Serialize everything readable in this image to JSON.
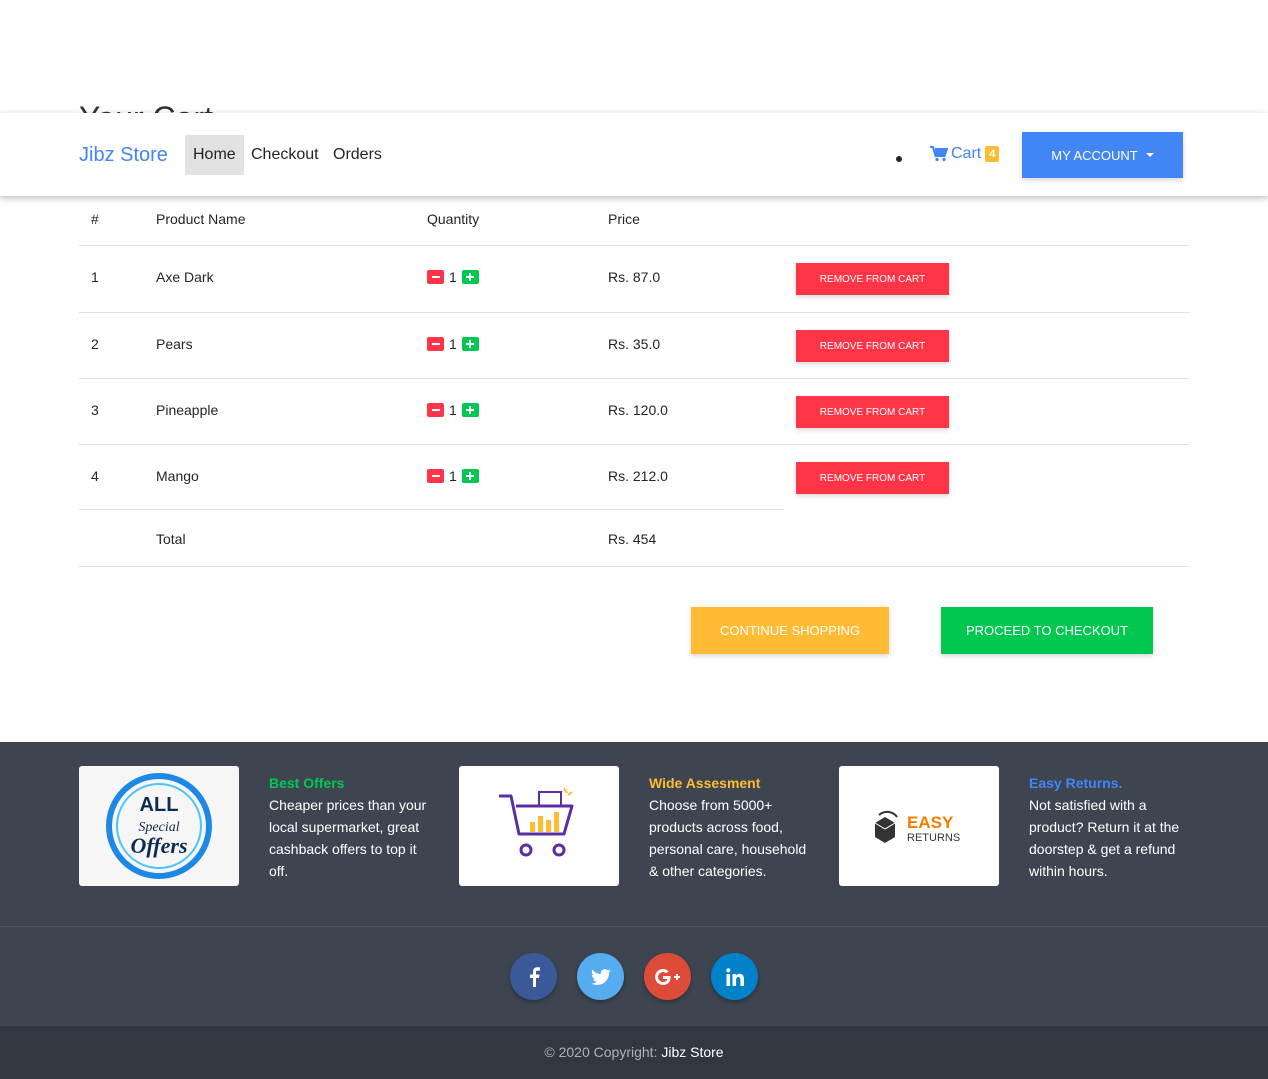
{
  "page": {
    "heading": "Your Cart"
  },
  "navbar": {
    "brand": "Jibz Store",
    "links": [
      "Home",
      "Checkout",
      "Orders"
    ],
    "cart_label": "Cart",
    "cart_count": "4",
    "account_label": "My Account"
  },
  "table": {
    "headers": [
      "#",
      "Product Name",
      "Quantity",
      "Price"
    ],
    "rows": [
      {
        "num": "1",
        "name": "Axe Dark",
        "qty": "1",
        "price": "Rs. 87.0",
        "action": "Remove from cart"
      },
      {
        "num": "2",
        "name": "Pears",
        "qty": "1",
        "price": "Rs. 35.0",
        "action": "Remove from cart"
      },
      {
        "num": "3",
        "name": "Pineapple",
        "qty": "1",
        "price": "Rs. 120.0",
        "action": "Remove from cart"
      },
      {
        "num": "4",
        "name": "Mango",
        "qty": "1",
        "price": "Rs. 212.0",
        "action": "Remove from cart"
      }
    ],
    "total_label": "Total",
    "total_value": "Rs. 454"
  },
  "actions": {
    "continue": "Continue Shopping",
    "checkout": "Proceed to Checkout"
  },
  "features": [
    {
      "title": "Best Offers",
      "text": "Cheaper prices than your local supermarket, great cashback offers to top it off.",
      "color": "#00c851",
      "image_text": [
        "ALL",
        "Special",
        "Offers"
      ]
    },
    {
      "title": "Wide Assesment",
      "text": "Choose from 5000+ products across food, personal care, household & other categories.",
      "color": "#ffbb33"
    },
    {
      "title": "Easy Returns.",
      "text": "Not satisfied with a product? Return it at the doorstep & get a refund within hours.",
      "color": "#4285f4",
      "image_text": [
        "EASY",
        "RETURNS"
      ]
    }
  ],
  "social": [
    {
      "icon": "facebook-icon",
      "glyph": "f",
      "color": "#3b5998"
    },
    {
      "icon": "twitter-icon",
      "glyph": "t",
      "color": "#55acee"
    },
    {
      "icon": "google-plus-icon",
      "glyph": "G+",
      "color": "#dd4b39"
    },
    {
      "icon": "linkedin-icon",
      "glyph": "in",
      "color": "#0082ca"
    }
  ],
  "footer": {
    "copyright": "© 2020 Copyright: ",
    "store": "Jibz Store"
  }
}
